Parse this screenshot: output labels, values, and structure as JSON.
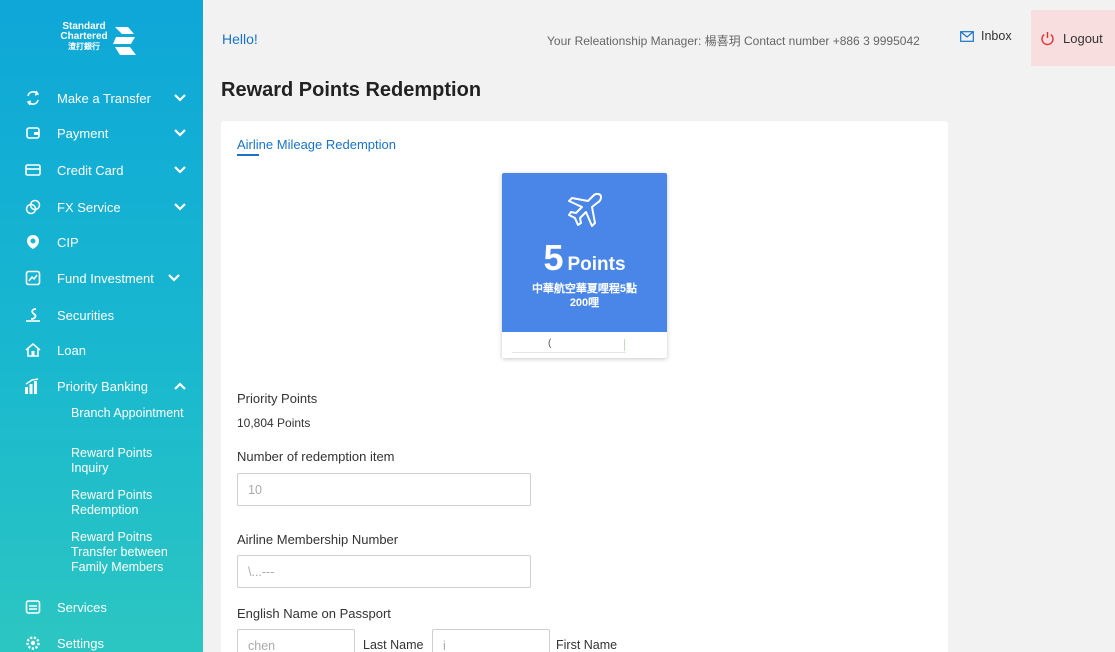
{
  "brand": {
    "line1": "Standard",
    "line2": "Chartered",
    "line3": "渣打銀行"
  },
  "sidebar": {
    "items": [
      {
        "label": "Make a Transfer",
        "icon": "transfer-icon"
      },
      {
        "label": "Payment",
        "icon": "wallet-icon"
      },
      {
        "label": "Credit Card",
        "icon": "credit-card-icon"
      },
      {
        "label": "FX Service",
        "icon": "fx-icon"
      },
      {
        "label": "CIP",
        "icon": "cip-icon"
      },
      {
        "label": "Fund Investment",
        "icon": "fund-icon"
      },
      {
        "label": "Securities",
        "icon": "securities-icon"
      },
      {
        "label": "Loan",
        "icon": "home-icon"
      },
      {
        "label": "Priority Banking",
        "icon": "priority-banking-icon"
      },
      {
        "label": "Services",
        "icon": "services-icon"
      },
      {
        "label": "Settings",
        "icon": "settings-icon"
      }
    ],
    "sub_items": [
      {
        "label": "Branch Appointment"
      },
      {
        "label": "Reward Points Inquiry"
      },
      {
        "label": "Reward Points Redemption"
      },
      {
        "label": "Reward Poitns Transfer between Family Members"
      }
    ]
  },
  "header": {
    "greeting": "Hello!",
    "rm_text": "Your Releationship Manager: 楊喜玥 Contact number +886 3 9995042",
    "inbox_label": "Inbox",
    "logout_label": "Logout"
  },
  "page": {
    "title": "Reward Points Redemption",
    "tab_label": "Airline Mileage Redemption"
  },
  "reward": {
    "points_number": "5",
    "points_unit": "Points",
    "desc_line1": "中華航空華夏哩程5點",
    "desc_line2": "200哩",
    "bottom_text": "("
  },
  "form": {
    "priority_points_label": "Priority Points",
    "priority_points_value": "10,804 Points",
    "redemption_count_label": "Number of redemption item",
    "redemption_count_value": "10",
    "membership_label": "Airline Membership Number",
    "membership_value": "\\...---",
    "passport_label": "English Name on Passport",
    "last_name_value": "chen",
    "last_name_label": "Last Name",
    "first_name_value": "i",
    "first_name_label": "First Name"
  },
  "colors": {
    "sidebar_top": "#0ea7d8",
    "sidebar_bottom": "#2cc6c2",
    "accent_blue": "#1a73c8",
    "tile_blue": "#4a86e8",
    "logout_bg": "#f8dede"
  }
}
